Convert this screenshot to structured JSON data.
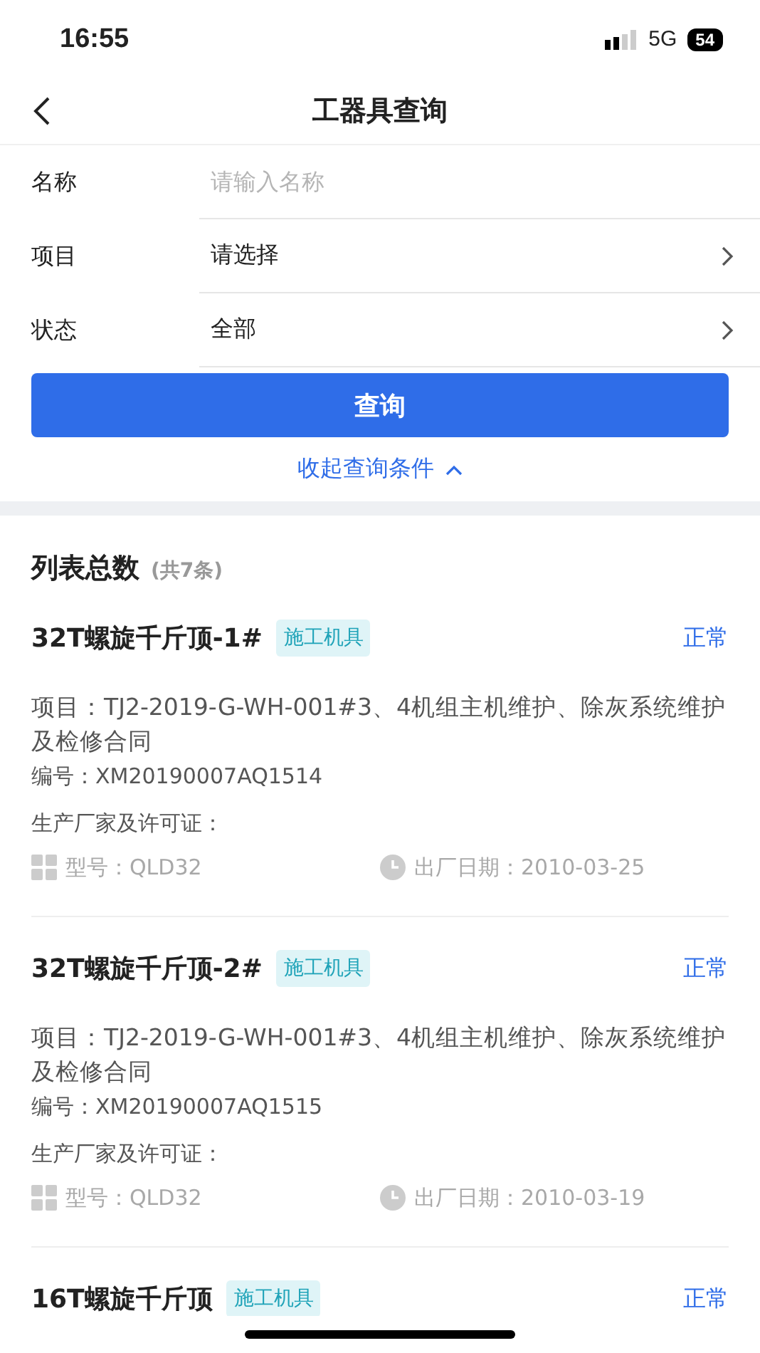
{
  "status_bar": {
    "time": "16:55",
    "network": "5G",
    "battery": "54"
  },
  "nav": {
    "title": "工器具查询"
  },
  "form": {
    "fields": [
      {
        "kind": "input",
        "label": "名称",
        "placeholder": "请输入名称"
      },
      {
        "kind": "select",
        "label": "项目",
        "value": "请选择"
      },
      {
        "kind": "select",
        "label": "状态",
        "value": "全部"
      }
    ],
    "query_button": "查询",
    "collapse_link": "收起查询条件"
  },
  "list": {
    "title": "列表总数",
    "count": "(共7条)",
    "items": [
      {
        "name": "32T螺旋千斤顶-1#",
        "tag": "施工机具",
        "status": "正常",
        "project": "项目：TJ2-2019-G-WH-001#3、4机组主机维护、除灰系统维护及检修合同",
        "code": "编号：XM20190007AQ1514",
        "maker": "生产厂家及许可证：",
        "model": "型号：QLD32",
        "date": "出厂日期：2010-03-25"
      },
      {
        "name": "32T螺旋千斤顶-2#",
        "tag": "施工机具",
        "status": "正常",
        "project": "项目：TJ2-2019-G-WH-001#3、4机组主机维护、除灰系统维护及检修合同",
        "code": "编号：XM20190007AQ1515",
        "maker": "生产厂家及许可证：",
        "model": "型号：QLD32",
        "date": "出厂日期：2010-03-19"
      },
      {
        "name": "16T螺旋千斤顶",
        "tag": "施工机具",
        "status": "正常"
      }
    ]
  }
}
